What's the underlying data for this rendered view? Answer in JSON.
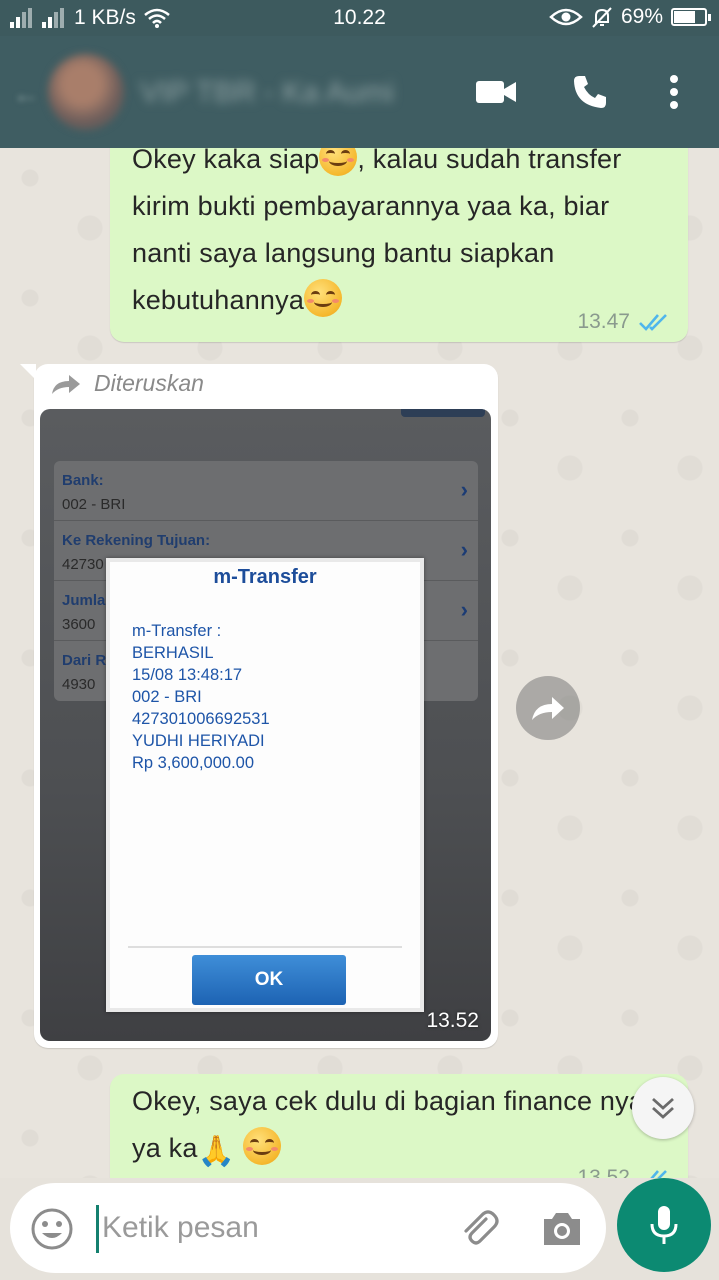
{
  "status_bar": {
    "network": "1 KB/s",
    "time": "10.22",
    "battery": "69%",
    "battery_level": 0.69
  },
  "header": {
    "contact_name": "VIP TBR - Ka Aumi",
    "icons": [
      "back-arrow-icon",
      "video-call-icon",
      "phone-icon",
      "more-vert-icon"
    ]
  },
  "messages": [
    {
      "direction": "outgoing",
      "lines": [
        "Okey kaka siap",
        ", kalau sudah transfer",
        "kirim bukti pembayarannya yaa ka, biar",
        "nanti saya langsung bantu siapkan",
        "kebutuhannya"
      ],
      "time": "13.47",
      "status": "read"
    },
    {
      "direction": "incoming",
      "forwarded_label": "Diteruskan",
      "image": {
        "panel_rows": [
          {
            "label": "Bank:",
            "value": "002 - BRI"
          },
          {
            "label": "Ke Rekening Tujuan:",
            "value": "42730"
          },
          {
            "label": "Jumla",
            "value": "3600"
          },
          {
            "label": "Dari R",
            "value": "4930"
          }
        ],
        "dialog": {
          "title": "m-Transfer",
          "lines": [
            "m-Transfer :",
            "BERHASIL",
            "15/08 13:48:17",
            "002 - BRI",
            "427301006692531",
            "YUDHI HERIYADI",
            "Rp 3,600,000.00"
          ],
          "ok_label": "OK"
        }
      },
      "time": "13.52"
    },
    {
      "direction": "outgoing",
      "lines": [
        "Okey, saya cek dulu di bagian finance nya",
        "ya ka"
      ],
      "time": "13.52",
      "status": "read"
    }
  ],
  "composer": {
    "placeholder": "Ketik pesan"
  },
  "colors": {
    "header": "#3f5d62",
    "outgoing_bubble": "#dcf8c6",
    "accent": "#0c8a72",
    "read_ticks": "#4fb6ec"
  }
}
